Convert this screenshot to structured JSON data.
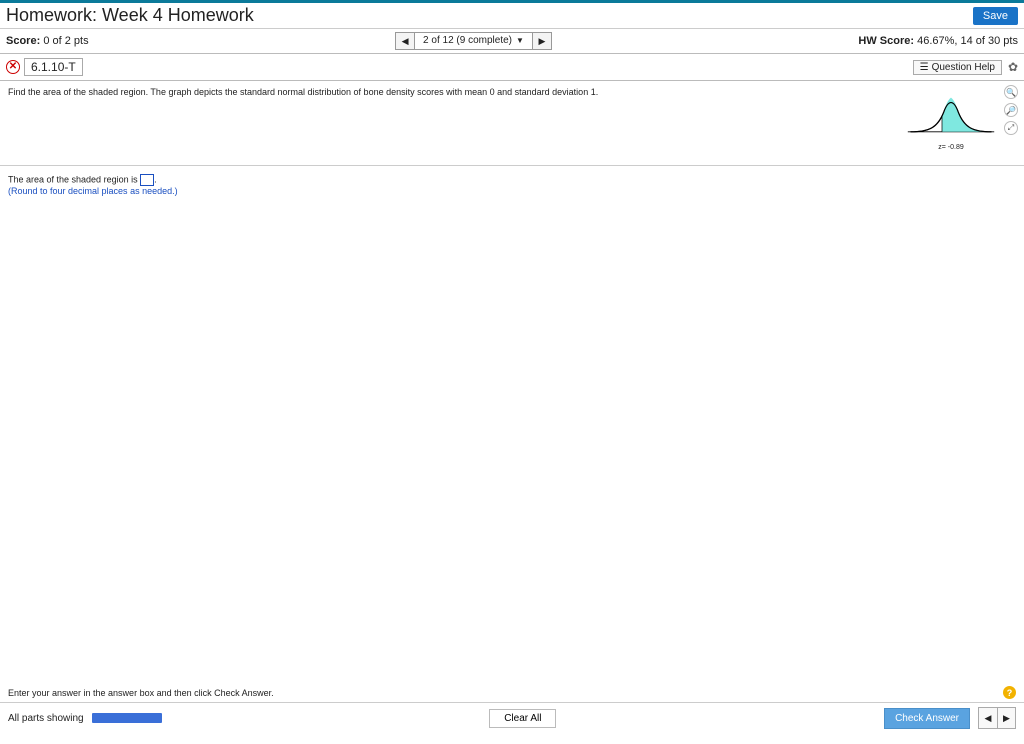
{
  "header": {
    "title": "Homework: Week 4 Homework",
    "save_label": "Save"
  },
  "scorebar": {
    "score_label": "Score:",
    "score_value": "0 of 2 pts",
    "nav_label": "2 of 12 (9 complete)",
    "hw_label": "HW Score:",
    "hw_value": "46.67%, 14 of 30 pts"
  },
  "qbar": {
    "qnum": "6.1.10-T",
    "help_label": "Question Help"
  },
  "question": {
    "text": "Find the area of the shaded region. The graph depicts the standard normal distribution of bone density scores with mean 0 and standard deviation 1.",
    "chart_caption": "z= -0.89"
  },
  "answer": {
    "prefix": "The area of the shaded region is ",
    "round": "(Round to four decimal places as needed.)"
  },
  "footer": {
    "hint": "Enter your answer in the answer box and then click Check Answer.",
    "parts": "All parts showing",
    "clear": "Clear All",
    "check": "Check Answer"
  },
  "chart_data": {
    "type": "area",
    "title": "Standard normal distribution",
    "mean": 0,
    "sd": 1,
    "shaded_region": {
      "from": -0.89,
      "to": 4
    },
    "z_marker": -0.89,
    "xlim": [
      -4,
      4
    ]
  }
}
